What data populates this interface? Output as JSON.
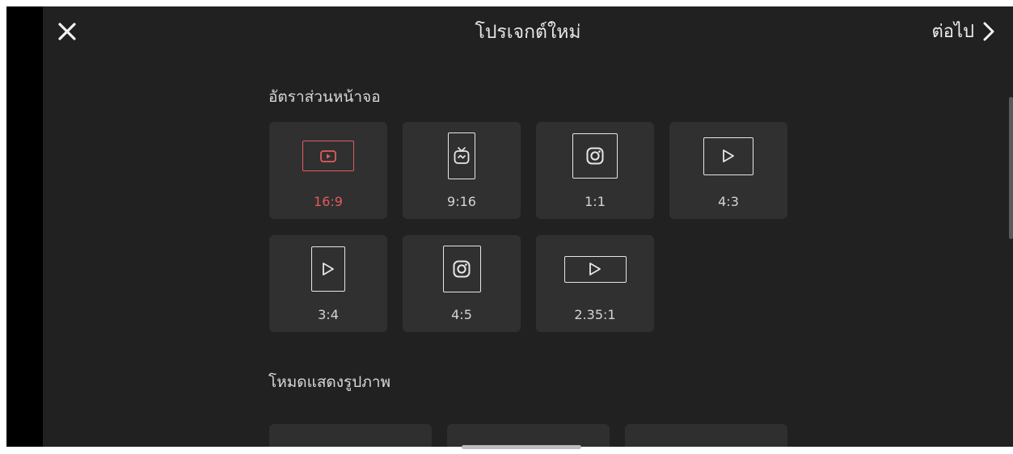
{
  "header": {
    "title": "โปรเจกต์ใหม่",
    "next_label": "ต่อไป"
  },
  "aspect_section": {
    "title": "อัตราส่วนหน้าจอ",
    "options": [
      {
        "label": "16:9",
        "icon": "youtube-icon",
        "selected": true
      },
      {
        "label": "9:16",
        "icon": "igtv-icon",
        "selected": false
      },
      {
        "label": "1:1",
        "icon": "instagram-icon",
        "selected": false
      },
      {
        "label": "4:3",
        "icon": "play-icon",
        "selected": false
      },
      {
        "label": "3:4",
        "icon": "play-icon",
        "selected": false
      },
      {
        "label": "4:5",
        "icon": "instagram-icon",
        "selected": false
      },
      {
        "label": "2.35:1",
        "icon": "play-icon",
        "selected": false
      }
    ]
  },
  "display_mode_section": {
    "title": "โหมดแสดงรูปภาพ"
  },
  "colors": {
    "accent": "#e25b5b",
    "background": "#212121",
    "tile": "#303030"
  }
}
